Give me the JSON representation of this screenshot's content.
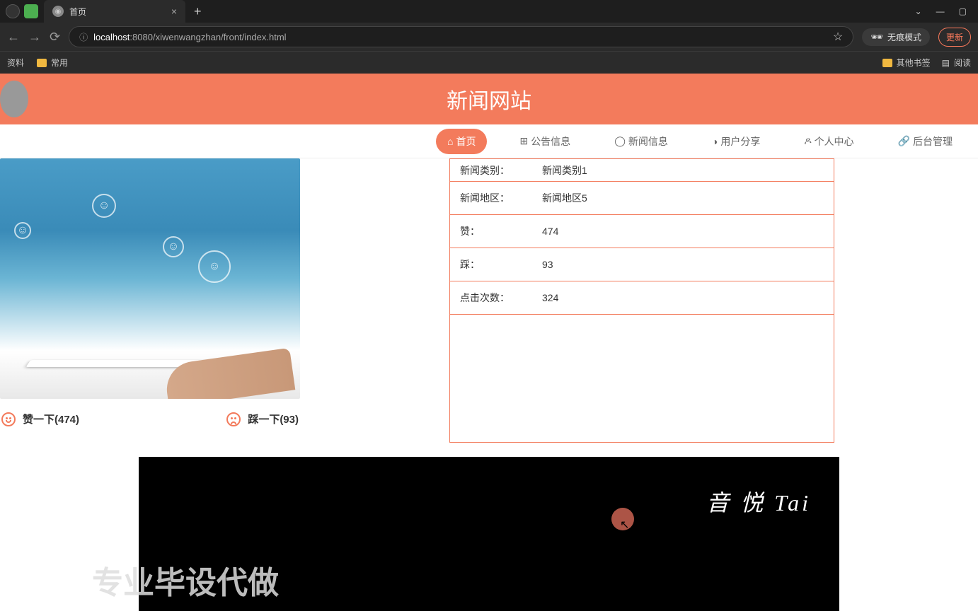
{
  "browser": {
    "tab_title": "首页",
    "url_host": "localhost",
    "url_path": ":8080/xiwenwangzhan/front/index.html",
    "incognito_label": "无痕模式",
    "update_label": "更新",
    "star_icon": "☆"
  },
  "bookmarks": {
    "item1": "资料",
    "item2": "常用",
    "other": "其他书签",
    "reading": "阅读"
  },
  "site": {
    "title": "新闻网站"
  },
  "nav": {
    "home": "首页",
    "notice": "公告信息",
    "news": "新闻信息",
    "share": "用户分享",
    "personal": "个人中心",
    "admin": "后台管理"
  },
  "info": {
    "category_label": "新闻类别：",
    "category_value": "新闻类别1",
    "region_label": "新闻地区：",
    "region_value": "新闻地区5",
    "likes_label": "赞：",
    "likes_value": "474",
    "dislikes_label": "踩：",
    "dislikes_value": "93",
    "clicks_label": "点击次数：",
    "clicks_value": "324"
  },
  "reactions": {
    "like_text": "赞一下(474)",
    "dislike_text": "踩一下(93)"
  },
  "video": {
    "logo": "音 悦 Tai"
  },
  "watermark": "专业毕设代做"
}
